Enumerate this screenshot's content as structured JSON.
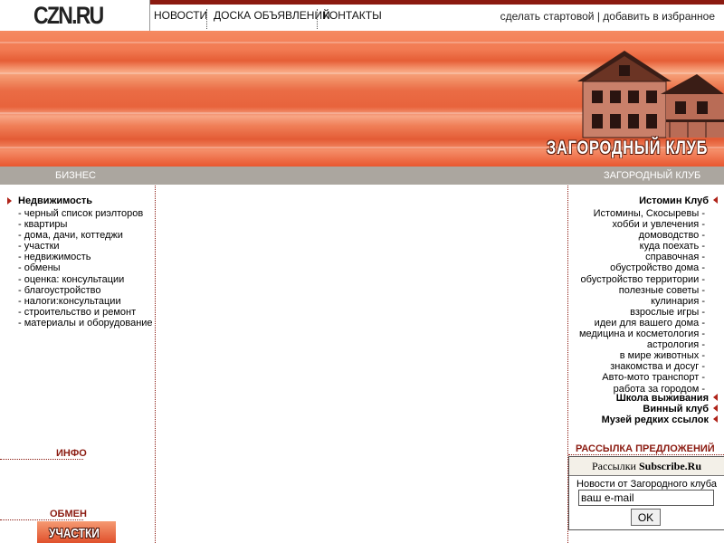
{
  "logo": {
    "text": "CZN.RU"
  },
  "topnav": {
    "items": [
      "НОВОСТИ",
      "ДОСКА ОБЪЯВЛЕНИЙ",
      "КОНТАКТЫ"
    ],
    "set_home": "сделать стартовой",
    "separator": "|",
    "add_favorites": "добавить в избранное"
  },
  "banner": {
    "title": "ЗАГОРОДНЫЙ   КЛУБ"
  },
  "graybar": {
    "left_label": "БИЗНЕС",
    "right_label": "ЗАГОРОДНЫЙ КЛУБ"
  },
  "left": {
    "heading": "Недвижимость",
    "items": [
      "- черный список риэлторов",
      "- квартиры",
      "- дома, дачи, коттеджи",
      "- участки",
      "- недвижимость",
      "- обмены",
      "- оценка: консультации",
      "- благоустройство",
      "- налоги:консультации",
      "- строительство и ремонт",
      "- материалы и оборудование"
    ],
    "info_title": "ИНФО",
    "exchange_title": "ОБМЕН",
    "exchange_button": "УЧАСТКИ"
  },
  "right": {
    "heading": "Истомин Клуб",
    "items": [
      "Истомины, Скосыревы -",
      "хобби и увлечения -",
      "домоводство -",
      "куда поехать -",
      "справочная -",
      "обустройство дома -",
      "обустройство территории -",
      "полезные советы -",
      "кулинария -",
      "взрослые игры -",
      "идеи для вашего дома -",
      "медицина и косметология -",
      "астрология -",
      "в мире животных -",
      "знакомства и досуг -",
      "Авто-мото транспорт -",
      "работа за городом -"
    ],
    "extra_headings": [
      "Школа выживания",
      "Винный клуб",
      "Музей редких ссылок"
    ],
    "newsletter_title": "РАССЫЛКА ПРЕДЛОЖЕНИЙ"
  },
  "subscribe": {
    "header_prefix": "Рассылки ",
    "header_brand": "Subscribe.Ru",
    "text": "Новости от Загородного клуба",
    "input_value": "ваш e-mail",
    "button": "OK"
  },
  "colors": {
    "accent": "#8b1a10",
    "banner": "#f27a52",
    "graybar": "#aba69f",
    "arrow": "#b0241a"
  }
}
